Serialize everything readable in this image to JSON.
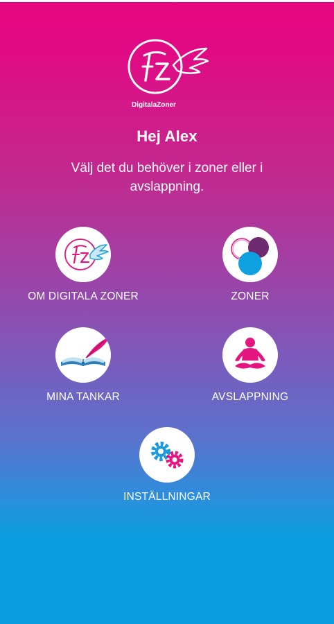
{
  "app": {
    "logo_name": "DigitalaZoner",
    "logo_monogram": "FZ"
  },
  "header": {
    "greeting": "Hej Alex",
    "subtitle": "Välj det du behöver i zoner eller i avslappning."
  },
  "menu": [
    {
      "label": "OM DIGITALA ZONER",
      "icon": "digitala-zoner-logo-icon"
    },
    {
      "label": "ZONER",
      "icon": "zones-circles-icon"
    },
    {
      "label": "MINA TANKAR",
      "icon": "book-quill-icon"
    },
    {
      "label": "AVSLAPPNING",
      "icon": "meditation-icon"
    },
    {
      "label": "INSTÄLLNINGAR",
      "icon": "gears-icon"
    }
  ],
  "colors": {
    "gradient_top": "#e8077f",
    "gradient_bottom": "#0a9ddf",
    "pink": "#e4157f",
    "purple": "#6e2b6f",
    "blue": "#0fa0e0",
    "lavender": "#cfa0cf"
  }
}
